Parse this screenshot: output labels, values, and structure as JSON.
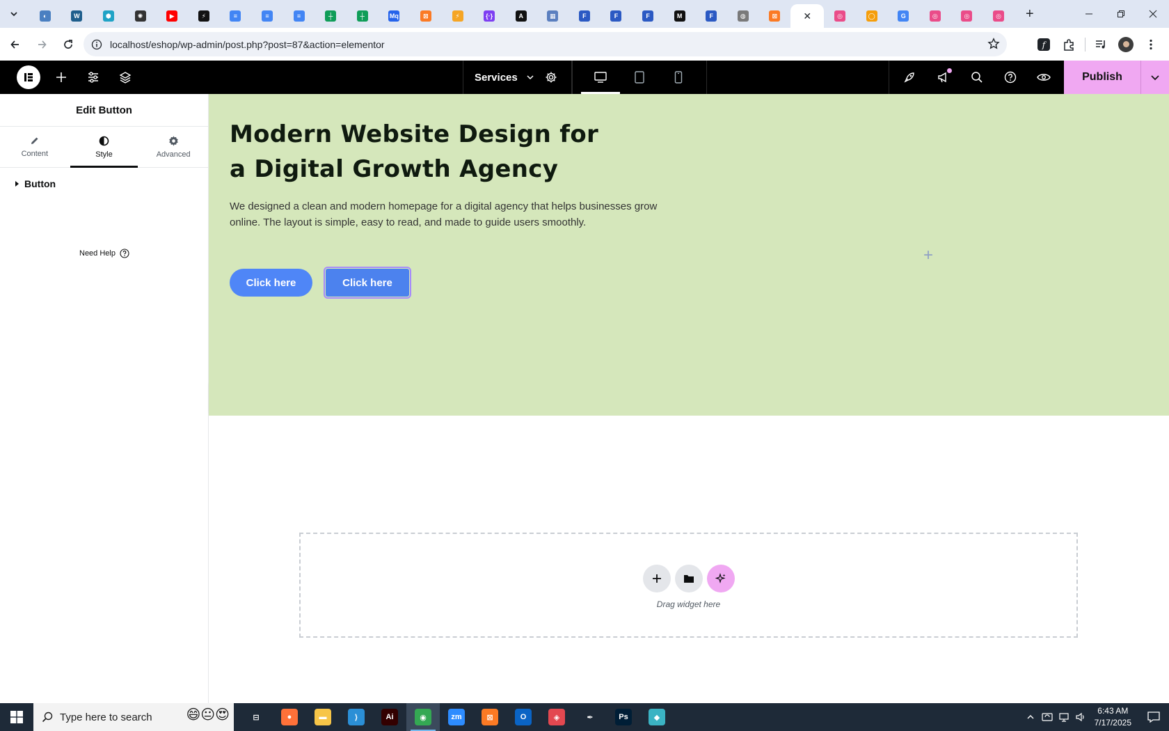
{
  "browser": {
    "tabs": [
      {
        "icon": "half-circle-blue",
        "color": "#4a7fc1",
        "glyph": "◐"
      },
      {
        "icon": "wordpress-icon",
        "color": "#1e5e8c",
        "glyph": "W"
      },
      {
        "icon": "hexagon-teal-icon",
        "color": "#1fa3c6",
        "glyph": "⬢"
      },
      {
        "icon": "openai-icon",
        "color": "#333333",
        "glyph": "✺"
      },
      {
        "icon": "youtube-icon",
        "color": "#ff0000",
        "glyph": "▶"
      },
      {
        "icon": "bolt-icon",
        "color": "#111111",
        "glyph": "⚡"
      },
      {
        "icon": "google-docs-icon",
        "color": "#4285f4",
        "glyph": "≡"
      },
      {
        "icon": "google-docs-icon",
        "color": "#4285f4",
        "glyph": "≡"
      },
      {
        "icon": "google-docs-icon",
        "color": "#4285f4",
        "glyph": "≡"
      },
      {
        "icon": "google-sheets-icon",
        "color": "#0f9d58",
        "glyph": "┼"
      },
      {
        "icon": "google-sheets-icon",
        "color": "#0f9d58",
        "glyph": "┼"
      },
      {
        "icon": "mq-icon",
        "color": "#2563eb",
        "glyph": "Mq"
      },
      {
        "icon": "xampp-icon",
        "color": "#fb7a24",
        "glyph": "⊠"
      },
      {
        "icon": "vite-icon",
        "color": "#f5a524",
        "glyph": "⚡"
      },
      {
        "icon": "braces-icon",
        "color": "#7e3ff2",
        "glyph": "{·}"
      },
      {
        "icon": "a-icon",
        "color": "#111111",
        "glyph": "A"
      },
      {
        "icon": "grid-icon",
        "color": "#5b7fbf",
        "glyph": "▦"
      },
      {
        "icon": "form-icon",
        "color": "#2b59c3",
        "glyph": "F"
      },
      {
        "icon": "form-icon",
        "color": "#2b59c3",
        "glyph": "F"
      },
      {
        "icon": "form-icon",
        "color": "#2b59c3",
        "glyph": "F"
      },
      {
        "icon": "m-icon",
        "color": "#111111",
        "glyph": "M"
      },
      {
        "icon": "form-icon",
        "color": "#2b59c3",
        "glyph": "F"
      },
      {
        "icon": "globe-icon",
        "color": "#7a7a7a",
        "glyph": "◍"
      },
      {
        "icon": "xampp-icon",
        "color": "#fb7a24",
        "glyph": "⊠"
      },
      {
        "icon": "active-tab",
        "color": "#ffffff",
        "glyph": "✕"
      },
      {
        "icon": "dribbble-icon",
        "color": "#ea4c89",
        "glyph": "◎"
      },
      {
        "icon": "ring-icon",
        "color": "#f59e0b",
        "glyph": "◯"
      },
      {
        "icon": "google-icon",
        "color": "#4285f4",
        "glyph": "G"
      },
      {
        "icon": "dribbble-icon",
        "color": "#ea4c89",
        "glyph": "◎"
      },
      {
        "icon": "dribbble-icon",
        "color": "#ea4c89",
        "glyph": "◎"
      },
      {
        "icon": "dribbble-icon",
        "color": "#ea4c89",
        "glyph": "◎"
      }
    ],
    "url": "localhost/eshop/wp-admin/post.php?post=87&action=elementor"
  },
  "editor": {
    "page_name": "Services",
    "publish_label": "Publish",
    "accent_color": "#f0a8f2"
  },
  "panel": {
    "title": "Edit Button",
    "tabs": [
      {
        "label": "Content",
        "icon": "pencil-icon"
      },
      {
        "label": "Style",
        "icon": "contrast-icon"
      },
      {
        "label": "Advanced",
        "icon": "gear-icon"
      }
    ],
    "active_tab": "Style",
    "section_label": "Button",
    "help_label": "Need Help"
  },
  "canvas": {
    "heading": "Modern Website Design for a Digital Growth Agency",
    "paragraph": "We designed a clean and modern homepage for a digital agency that helps businesses grow online. The layout is simple, easy to read, and made to guide users smoothly.",
    "button1_label": "Click here",
    "button2_label": "Click here",
    "hero_bg": "#d5e7bb",
    "drop_text": "Drag widget here"
  },
  "taskbar": {
    "search_placeholder": "Type here to search",
    "time": "6:43 AM",
    "date": "7/17/2025",
    "apps": [
      {
        "name": "task-view-icon",
        "label": "⊟",
        "color": "transparent"
      },
      {
        "name": "firefox-icon",
        "label": "●",
        "color": "#ff7139"
      },
      {
        "name": "file-explorer-icon",
        "label": "▬",
        "color": "#f7c548"
      },
      {
        "name": "vscode-icon",
        "label": "⟩",
        "color": "#2b8fd6"
      },
      {
        "name": "illustrator-icon",
        "label": "Ai",
        "color": "#330000"
      },
      {
        "name": "chrome-icon",
        "label": "◉",
        "color": "#34a853"
      },
      {
        "name": "zoom-icon",
        "label": "zm",
        "color": "#2d8cff"
      },
      {
        "name": "xampp-icon",
        "label": "⊠",
        "color": "#fb7a24"
      },
      {
        "name": "outlook-icon",
        "label": "O",
        "color": "#0a64c5"
      },
      {
        "name": "creative-cloud-icon",
        "label": "◈",
        "color": "#e34850"
      },
      {
        "name": "pen-tool-icon",
        "label": "✒",
        "color": "transparent"
      },
      {
        "name": "photoshop-icon",
        "label": "Ps",
        "color": "#001e36"
      },
      {
        "name": "app-icon",
        "label": "◆",
        "color": "#3bb3c3"
      }
    ]
  }
}
